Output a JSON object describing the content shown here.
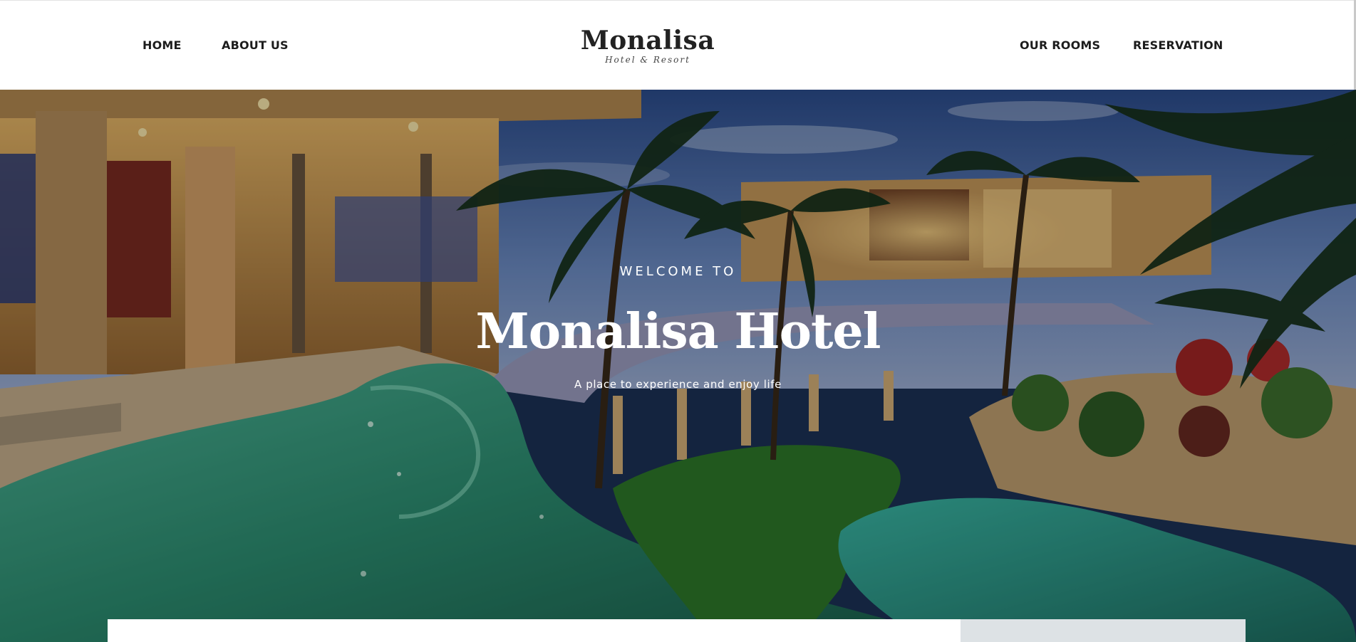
{
  "nav": {
    "left": [
      {
        "label": "HOME"
      },
      {
        "label": "ABOUT US"
      }
    ],
    "right": [
      {
        "label": "OUR ROOMS"
      },
      {
        "label": "RESERVATION"
      }
    ]
  },
  "logo": {
    "name": "Monalisa",
    "tagline": "Hotel & Resort"
  },
  "hero": {
    "kicker": "WELCOME TO",
    "title": "Monalisa Hotel",
    "subtitle": "A place to experience and enjoy life"
  },
  "colors": {
    "nav_text": "#1c1c1c",
    "hero_text": "#ffffff",
    "booking_accent": "#dde2e5"
  }
}
